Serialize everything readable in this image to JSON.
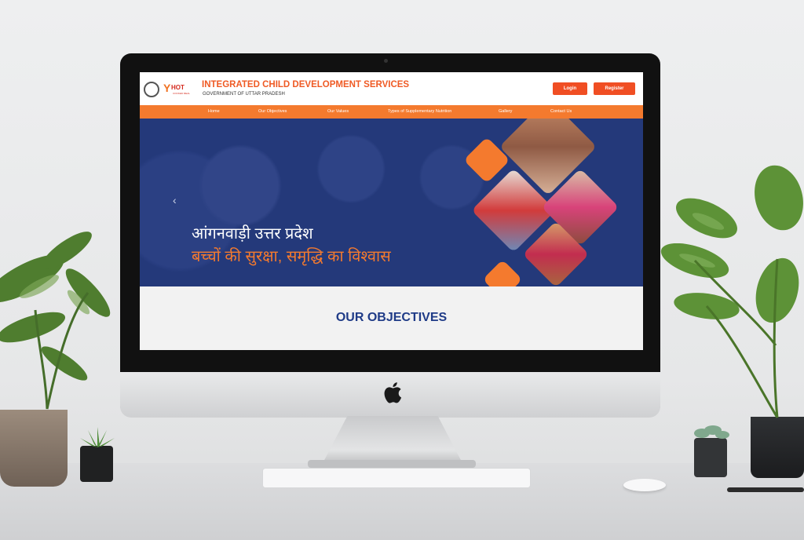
{
  "header": {
    "title": "INTEGRATED CHILD DEVELOPMENT SERVICES",
    "subtitle": "GOVERNMENT OF UTTAR PRADESH",
    "login_label": "Login",
    "register_label": "Register",
    "hcm_logo_main": "HOT",
    "hcm_logo_sub": "COOKED MEAL"
  },
  "nav": {
    "items": [
      "Home",
      "Our Objectives",
      "Our Values",
      "Types of Supplementary Nutrition",
      "Gallery",
      "Contact Us"
    ]
  },
  "hero": {
    "line1": "आंगनवाड़ी उत्तर प्रदेश",
    "line2": "बच्चों की सुरक्षा, समृद्धि का विश्वास"
  },
  "objectives": {
    "title": "OUR OBJECTIVES"
  },
  "colors": {
    "accent_orange": "#f47a2e",
    "button_orange": "#f04e23",
    "hero_blue": "#24397a",
    "heading_blue": "#1f3b87"
  }
}
